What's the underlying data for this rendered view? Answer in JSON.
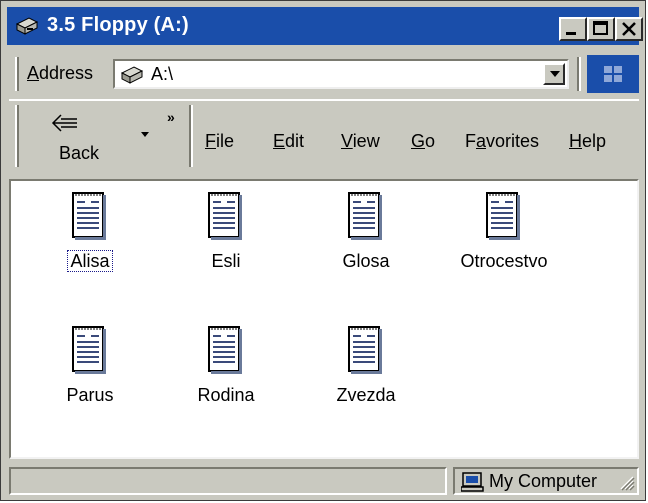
{
  "window": {
    "title": "3.5 Floppy (A:)",
    "title_color": "#1a4eaa",
    "face_color": "#c9c9c0"
  },
  "address_bar": {
    "label_prefix": "A",
    "label_rest": "ddress",
    "value": "A:\\"
  },
  "toolbar": {
    "back_label": "Back",
    "chevron": "»",
    "menus": [
      {
        "u": "F",
        "rest": "ile"
      },
      {
        "u": "E",
        "rest": "dit"
      },
      {
        "u": "V",
        "rest": "iew"
      },
      {
        "u": "G",
        "rest": "o"
      },
      {
        "u": "",
        "pre": "F",
        "u2": "a",
        "rest": "vorites"
      },
      {
        "u": "H",
        "rest": "elp"
      }
    ]
  },
  "files": [
    {
      "name": "Alisa",
      "selected": true
    },
    {
      "name": "Esli",
      "selected": false
    },
    {
      "name": "Glosa",
      "selected": false
    },
    {
      "name": "Otrocestvo",
      "selected": false
    },
    {
      "name": "Parus",
      "selected": false
    },
    {
      "name": "Rodina",
      "selected": false
    },
    {
      "name": "Zvezda",
      "selected": false
    }
  ],
  "status": {
    "zone": "My Computer"
  },
  "icons": [
    "floppy-drive-icon",
    "minimize-icon",
    "maximize-icon",
    "close-icon",
    "chevron-down-icon",
    "windows-logo-icon",
    "back-arrow-icon",
    "document-icon",
    "my-computer-icon",
    "resize-grip-icon"
  ]
}
